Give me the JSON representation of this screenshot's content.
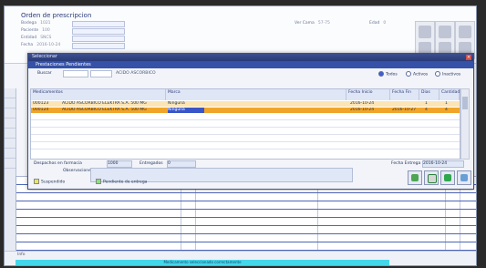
{
  "app": {
    "title": "Orden de prescripcion",
    "header_fields": [
      {
        "label": "Bodega",
        "value": "1021"
      },
      {
        "label": "Paciente",
        "value": "100"
      },
      {
        "label": "Entidad",
        "value": "SNCS"
      },
      {
        "label": "Fecha",
        "value": "2016-10-24"
      }
    ],
    "right_fields": [
      {
        "label": "Ver Cama",
        "value": "57-75"
      },
      {
        "label": "Edad",
        "value": "0"
      }
    ]
  },
  "modal": {
    "title": "Seleccionar",
    "banner": "Prestaciones Pendientes",
    "filter_label": "Buscar",
    "filter_value": "ACIDO ASCORBICO",
    "radios": [
      {
        "label": "Todos",
        "on": true
      },
      {
        "label": "Activos",
        "on": false
      },
      {
        "label": "Inactivos",
        "on": false
      }
    ],
    "columns": [
      "Medicamentos",
      "Marca",
      "Fecha Inicio",
      "Fecha Fin",
      "Dias",
      "Cantidad"
    ],
    "rows": [
      {
        "code": "000123",
        "desc": "ACIDO ASCORBICO ELEKTRA S.A. 500 MG",
        "marca": "Ninguna",
        "inicio": "2016-10-24",
        "fin": "",
        "dias": "1",
        "cant": "1"
      },
      {
        "code": "000124",
        "desc": "ACIDO ASCORBICO ELEKTRA S.A. 500 MG",
        "marca": "Ninguna",
        "inicio": "2016-10-24",
        "fin": "2016-10-27",
        "dias": "4",
        "cant": "4"
      }
    ],
    "bottom": {
      "field1_label": "Despachos en farmacia",
      "field1_value": "1000",
      "field2_label": "Entregados",
      "field2_value": "0",
      "obs_label": "Observaciones",
      "date_label": "Fecha Entrega",
      "date_value": "2016-10-24"
    },
    "legend": [
      {
        "label": "Suspendido",
        "color": "#e6e664"
      },
      {
        "label": "Pendiente de entrega",
        "color": "#8adf80"
      }
    ]
  },
  "status": {
    "label": "Info",
    "message": "Medicamento seleccionado correctamente"
  }
}
